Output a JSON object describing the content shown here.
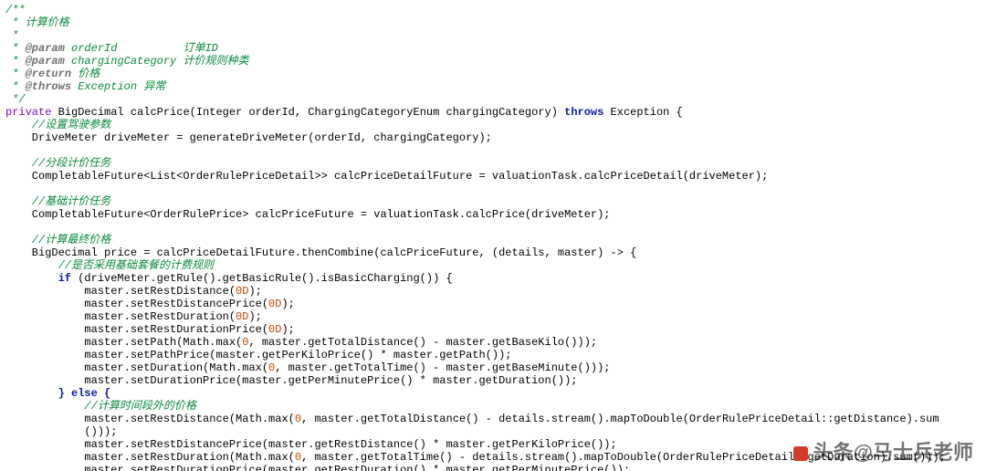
{
  "code": {
    "javadoc": {
      "open": "/**",
      "title": " * 计算价格",
      "blank": " *",
      "p1_tag": "@param",
      "p1_name": "orderId",
      "p1_desc": "订单ID",
      "p2_tag": "@param",
      "p2_name": "chargingCategory",
      "p2_desc": "计价规则种类",
      "ret_tag": "@return",
      "ret_desc": "价格",
      "thr_tag": "@throws",
      "thr_type": "Exception",
      "thr_desc": "异常",
      "close": " */"
    },
    "sig": {
      "modifier": "private",
      "rest": " BigDecimal calcPrice(Integer orderId, ChargingCategoryEnum chargingCategory) ",
      "throws": "throws",
      "tail": " Exception {"
    },
    "c1": "//设置驾驶参数",
    "l1": "    DriveMeter driveMeter = generateDriveMeter(orderId, chargingCategory);",
    "c2": "//分段计价任务",
    "l2": "    CompletableFuture<List<OrderRulePriceDetail>> calcPriceDetailFuture = valuationTask.calcPriceDetail(driveMeter);",
    "c3": "//基础计价任务",
    "l3": "    CompletableFuture<OrderRulePrice> calcPriceFuture = valuationTask.calcPrice(driveMeter);",
    "c4": "//计算最终价格",
    "l4": "    BigDecimal price = calcPriceDetailFuture.thenCombine(calcPriceFuture, (details, master) -> {",
    "c5": "//是否采用基础套餐的计费规则",
    "if_kw": "if",
    "if_cond": " (driveMeter.getRule().getBasicRule().isBasicCharging()) {",
    "b1a": "            master.setRestDistance(",
    "b1b": ");",
    "b2a": "            master.setRestDistancePrice(",
    "b2b": ");",
    "b3a": "            master.setRestDuration(",
    "b3b": ");",
    "b4a": "            master.setRestDurationPrice(",
    "b4b": ");",
    "b5a": "            master.setPath(Math.max(",
    "b5b": ", master.getTotalDistance() - master.getBaseKilo()));",
    "b6": "            master.setPathPrice(master.getPerKiloPrice() * master.getPath());",
    "b7a": "            master.setDuration(Math.max(",
    "b7b": ", master.getTotalTime() - master.getBaseMinute()));",
    "b8": "            master.setDurationPrice(master.getPerMinutePrice() * master.getDuration());",
    "else_close": "} ",
    "else_kw": "else",
    "else_open": " {",
    "c6": "//计算时间段外的价格",
    "e1a": "            master.setRestDistance(Math.max(",
    "e1b": ", master.getTotalDistance() - details.stream().mapToDouble(OrderRulePriceDetail::getDistance).sum",
    "e1c": "            ()));",
    "e2": "            master.setRestDistancePrice(master.getRestDistance() * master.getPerKiloPrice());",
    "e3a": "            master.setRestDuration(Math.max(",
    "e3b": ", master.getTotalTime() - details.stream().mapToDouble(OrderRulePriceDetail::getDuration).sum()));",
    "e4": "            master.setRestDurationPrice(master.getRestDuration() * master.getPerMinutePrice());",
    "num": {
      "zeroD": "0D",
      "zero": "0"
    }
  },
  "watermark": {
    "prefix": "头条",
    "handle": "@马士兵老师"
  }
}
